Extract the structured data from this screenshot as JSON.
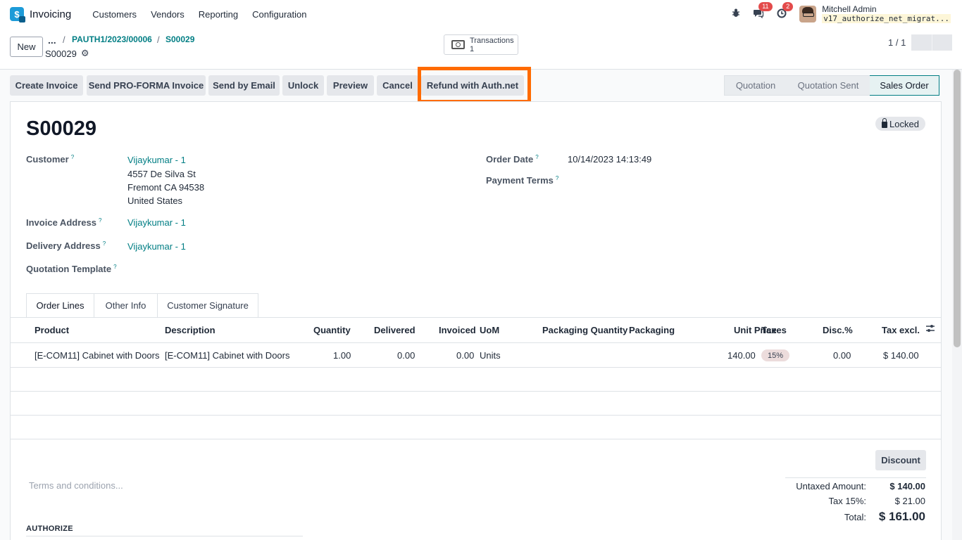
{
  "navbar": {
    "app_name": "Invoicing",
    "menu": [
      "Customers",
      "Vendors",
      "Reporting",
      "Configuration"
    ],
    "messages_count": "11",
    "activities_count": "2",
    "user_name": "Mitchell Admin",
    "database": "v17_authorize_net_migrat..."
  },
  "control": {
    "new_label": "New",
    "breadcrumb_dots": "...",
    "breadcrumb": [
      "PAUTH1/2023/00006",
      "S00029"
    ],
    "current_record": "S00029",
    "smart_button": {
      "label": "Transactions",
      "count": "1"
    },
    "pager": "1 / 1"
  },
  "actions": [
    "Create Invoice",
    "Send PRO-FORMA Invoice",
    "Send by Email",
    "Unlock",
    "Preview",
    "Cancel",
    "Refund with Auth.net"
  ],
  "statusbar": [
    "Quotation",
    "Quotation Sent",
    "Sales Order"
  ],
  "form": {
    "title": "S00029",
    "locked_label": "Locked",
    "customer_label": "Customer",
    "customer_name": "Vijaykumar - 1",
    "address_line1": "4557 De Silva St",
    "address_line2": "Fremont CA 94538",
    "address_line3": "United States",
    "invoice_address_label": "Invoice Address",
    "invoice_address": "Vijaykumar - 1",
    "delivery_address_label": "Delivery Address",
    "delivery_address": "Vijaykumar - 1",
    "quotation_template_label": "Quotation Template",
    "order_date_label": "Order Date",
    "order_date": "10/14/2023 14:13:49",
    "payment_terms_label": "Payment Terms",
    "help_mark": "?"
  },
  "tabs": [
    "Order Lines",
    "Other Info",
    "Customer Signature"
  ],
  "order_lines": {
    "columns": [
      "Product",
      "Description",
      "Quantity",
      "Delivered",
      "Invoiced",
      "UoM",
      "Packaging Quantity",
      "Packaging",
      "Unit Price",
      "Taxes",
      "Disc.%",
      "Tax excl."
    ],
    "rows": [
      {
        "product": "[E-COM11] Cabinet with Doors",
        "description": "[E-COM11] Cabinet with Doors",
        "quantity": "1.00",
        "delivered": "0.00",
        "invoiced": "0.00",
        "uom": "Units",
        "unit_price": "140.00",
        "taxes": "15%",
        "discount": "0.00",
        "subtotal": "$ 140.00"
      }
    ]
  },
  "footer": {
    "discount_label": "Discount",
    "terms_placeholder": "Terms and conditions...",
    "authorize_label": "AUTHORIZE",
    "untaxed_label": "Untaxed Amount:",
    "untaxed_value": "$ 140.00",
    "tax_label": "Tax 15%:",
    "tax_value": "$ 21.00",
    "total_label": "Total:",
    "total_value": "$ 161.00"
  },
  "colors": {
    "accent": "#017e84",
    "highlight": "#ff6b00",
    "badge": "#e34b4b"
  }
}
